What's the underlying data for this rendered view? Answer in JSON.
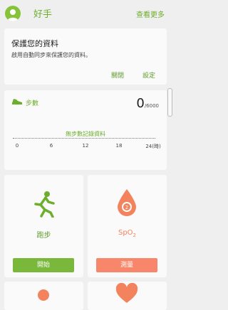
{
  "header": {
    "title": "好手",
    "more_label": "查看更多"
  },
  "protect": {
    "title": "保護您的資料",
    "description": "啟用自動同步來保護您的資料。",
    "dismiss_label": "關閉",
    "settings_label": "設定"
  },
  "steps": {
    "label": "步數",
    "count": "0",
    "goal": "/6000",
    "no_data": "無步數記錄資料",
    "axis_ticks": [
      "0",
      "6",
      "12",
      "18",
      "24(時)"
    ]
  },
  "tiles": {
    "running": {
      "label": "跑步",
      "button_label": "開始"
    },
    "spo2": {
      "label": "SpO",
      "label_sub": "2",
      "button_label": "測量"
    }
  },
  "colors": {
    "accent": "#6dae2d",
    "run_button": "#79b83a",
    "spo2": "#f2835c",
    "spo2_button": "#f7866a"
  }
}
